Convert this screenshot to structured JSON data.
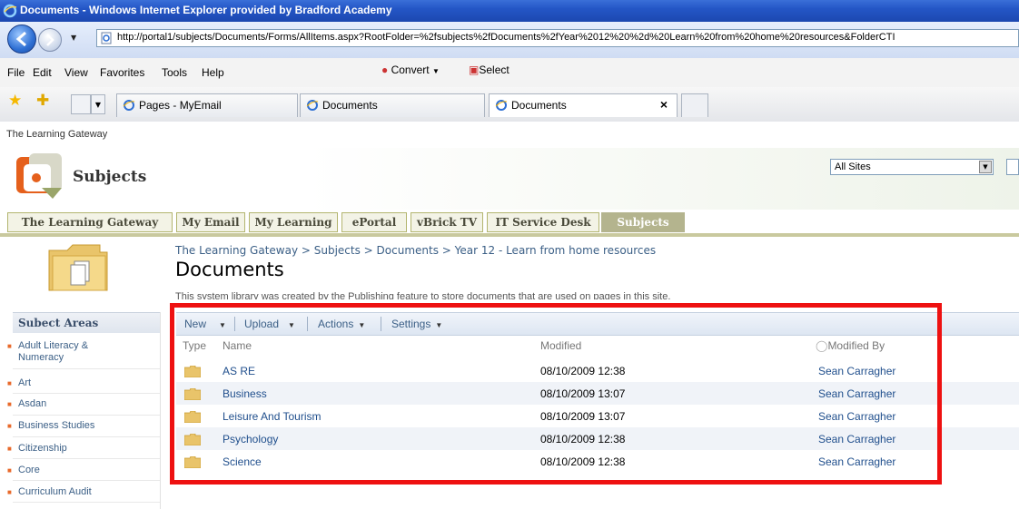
{
  "window": {
    "title": "Documents - Windows Internet Explorer provided by Bradford Academy",
    "url": "http://portal1/subjects/Documents/Forms/AllItems.aspx?RootFolder=%2fsubjects%2fDocuments%2fYear%2012%20%2d%20Learn%20from%20home%20resources&FolderCTI"
  },
  "menu": {
    "items": [
      "File",
      "Edit",
      "View",
      "Favorites",
      "Tools",
      "Help"
    ],
    "convert_label": "Convert",
    "select_label": "Select"
  },
  "tabs": [
    {
      "label": "Pages - MyEmail"
    },
    {
      "label": "Documents"
    },
    {
      "label": "Documents"
    }
  ],
  "site": {
    "gateway_label": "The Learning Gateway",
    "title": "Subjects",
    "search_scope": "All Sites"
  },
  "topnav": [
    "The Learning Gateway",
    "My Email",
    "My Learning",
    "ePortal",
    "vBrick TV",
    "IT Service Desk",
    "Subjects"
  ],
  "breadcrumb": "The Learning Gateway > Subjects > Documents > Year 12 - Learn from home resources",
  "page_title": "Documents",
  "description": "This system library was created by the Publishing feature to store documents that are used on pages in this site.",
  "leftnav": {
    "header": "Subect Areas",
    "items": [
      "Adult Literacy &",
      "Numeracy",
      "Art",
      "Asdan",
      "Business Studies",
      "Citizenship",
      "Core",
      "Curriculum Audit"
    ]
  },
  "toolbar": {
    "new_label": "New",
    "upload_label": "Upload",
    "actions_label": "Actions",
    "settings_label": "Settings"
  },
  "table": {
    "headers": [
      "Type",
      "Name",
      "Modified",
      "Modified By"
    ],
    "rows": [
      {
        "name": "AS RE",
        "modified": "08/10/2009 12:38",
        "modified_by": "Sean Carragher"
      },
      {
        "name": "Business",
        "modified": "08/10/2009 13:07",
        "modified_by": "Sean Carragher"
      },
      {
        "name": "Leisure And Tourism",
        "modified": "08/10/2009 13:07",
        "modified_by": "Sean Carragher"
      },
      {
        "name": "Psychology",
        "modified": "08/10/2009 12:38",
        "modified_by": "Sean Carragher"
      },
      {
        "name": "Science",
        "modified": "08/10/2009 12:38",
        "modified_by": "Sean Carragher"
      }
    ]
  },
  "colors": {
    "annotation_red": "#ee1111",
    "link_blue": "#1f4e8c",
    "nav_selected": "#b4b48e"
  }
}
